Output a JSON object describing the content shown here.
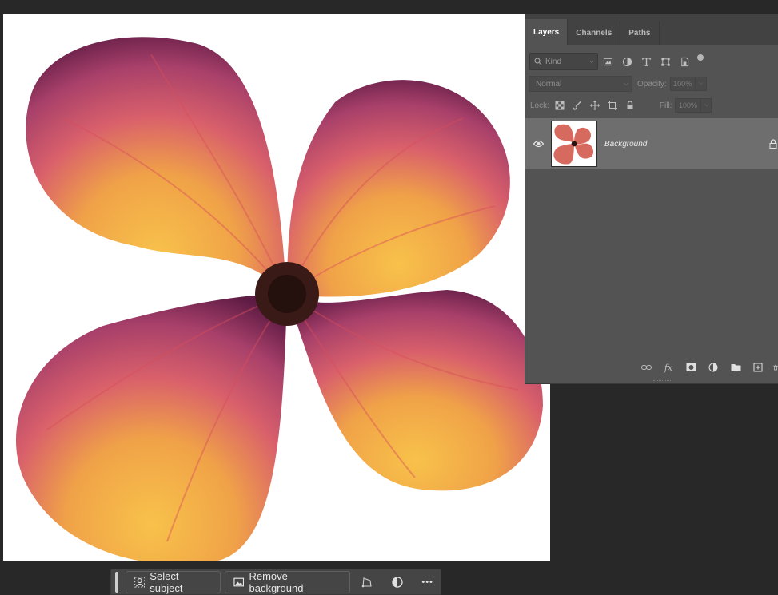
{
  "canvas": {
    "image": "flower-watercolor"
  },
  "layers_panel": {
    "tabs": [
      {
        "label": "Layers",
        "active": true
      },
      {
        "label": "Channels",
        "active": false
      },
      {
        "label": "Paths",
        "active": false
      }
    ],
    "filter": {
      "kind_label": "Kind"
    },
    "blend_mode": "Normal",
    "opacity_label": "Opacity:",
    "opacity_value": "100%",
    "lock_label": "Lock:",
    "fill_label": "Fill:",
    "fill_value": "100%",
    "layers": [
      {
        "name": "Background",
        "visible": true,
        "locked": true
      }
    ]
  },
  "taskbar": {
    "select_subject": "Select subject",
    "remove_background": "Remove background",
    "more": "•••"
  },
  "colors": {
    "app_bg": "#282828",
    "panel_bg": "#535353",
    "selected_layer": "#6e6e6e",
    "petal_dark": "#6b1e4a",
    "petal_mid": "#c8506a",
    "petal_center": "#f2b342"
  }
}
